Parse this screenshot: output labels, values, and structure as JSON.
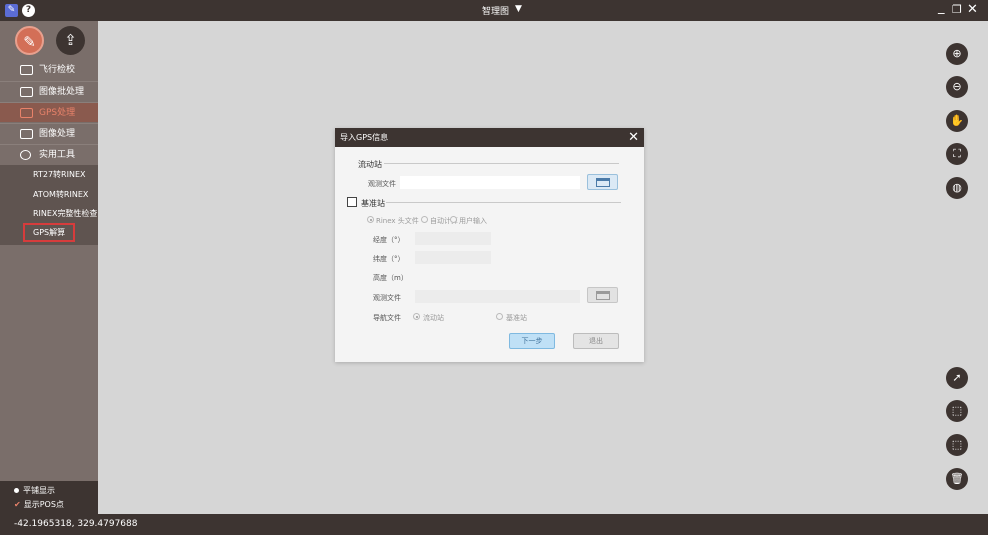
{
  "titlebar": {
    "logo_glyph": "✎",
    "help_glyph": "?",
    "title": "智理图",
    "caret": "▼",
    "minimize": "_",
    "restore": "❐",
    "close": "✕"
  },
  "sidebar": {
    "tools": [
      {
        "name": "brush-tool",
        "glyph": "✎"
      },
      {
        "name": "upload-tool",
        "glyph": "⇪"
      }
    ],
    "items": [
      {
        "label": "飞行检校"
      },
      {
        "label": "图像批处理"
      },
      {
        "label": "GPS处理"
      },
      {
        "label": "图像处理"
      },
      {
        "label": "实用工具"
      }
    ],
    "subitems": [
      {
        "label": "RT27转RINEX"
      },
      {
        "label": "ATOM转RINEX"
      },
      {
        "label": "RINEX完整性检查"
      },
      {
        "label": "GPS解算"
      }
    ],
    "bottom": {
      "tile_display": "平铺显示",
      "show_pos": "显示POS点",
      "check_glyph": "✔"
    }
  },
  "statusbar": {
    "coords": "-42.1965318, 329.4797688"
  },
  "right_toolbar": [
    {
      "name": "zoom-in-icon",
      "glyph": "⊕"
    },
    {
      "name": "zoom-out-icon",
      "glyph": "⊖"
    },
    {
      "name": "pan-hand-icon",
      "glyph": "✋"
    },
    {
      "name": "fullscreen-icon",
      "glyph": "⛶"
    },
    {
      "name": "globe-icon",
      "glyph": "◍"
    },
    {
      "name": "select-arrow-icon",
      "glyph": "➚"
    },
    {
      "name": "select-box-icon",
      "glyph": "⬚"
    },
    {
      "name": "deselect-box-icon",
      "glyph": "⬚"
    },
    {
      "name": "trash-icon",
      "glyph": "🗑"
    }
  ],
  "dialog": {
    "title": "导入GPS信息",
    "close_glyph": "✕",
    "rover_section": "流动站",
    "rover_obs_label": "观测文件",
    "rover_obs_value": "",
    "base_section": "基准站",
    "base_source_options": [
      "Rinex 头文件",
      "自动计算",
      "用户输入"
    ],
    "longitude_label": "经度（°）",
    "latitude_label": "纬度（°）",
    "height_label": "高度（m）",
    "base_obs_label": "观测文件",
    "nav_label": "导航文件",
    "nav_options": [
      "流动站",
      "基准站"
    ],
    "next_button": "下一步",
    "exit_button": "退出"
  }
}
